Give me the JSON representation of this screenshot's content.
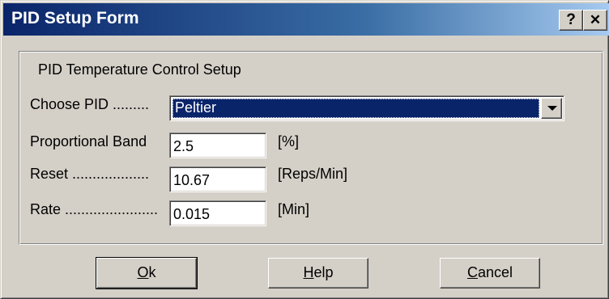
{
  "window": {
    "title": "PID Setup Form"
  },
  "caption_buttons": {
    "help": "?",
    "close": "✕"
  },
  "group": {
    "title": "PID Temperature Control Setup"
  },
  "fields": {
    "choose_pid": {
      "label": "Choose PID .........",
      "value": "Peltier"
    },
    "proportional_band": {
      "label": "Proportional Band",
      "value": "2.5",
      "unit": "[%]"
    },
    "reset": {
      "label": "Reset ...................",
      "value": "10.67",
      "unit": "[Reps/Min]"
    },
    "rate": {
      "label": "Rate .......................",
      "value": "0.015",
      "unit": "[Min]"
    }
  },
  "buttons": {
    "ok": {
      "mnemonic": "O",
      "rest": "k"
    },
    "help": {
      "mnemonic": "H",
      "rest": "elp"
    },
    "cancel": {
      "mnemonic": "C",
      "rest": "ancel"
    }
  },
  "colors": {
    "titlebar_start": "#0a246a",
    "titlebar_end": "#a6caf0",
    "face": "#d4d0c8",
    "selection": "#0a246a"
  }
}
